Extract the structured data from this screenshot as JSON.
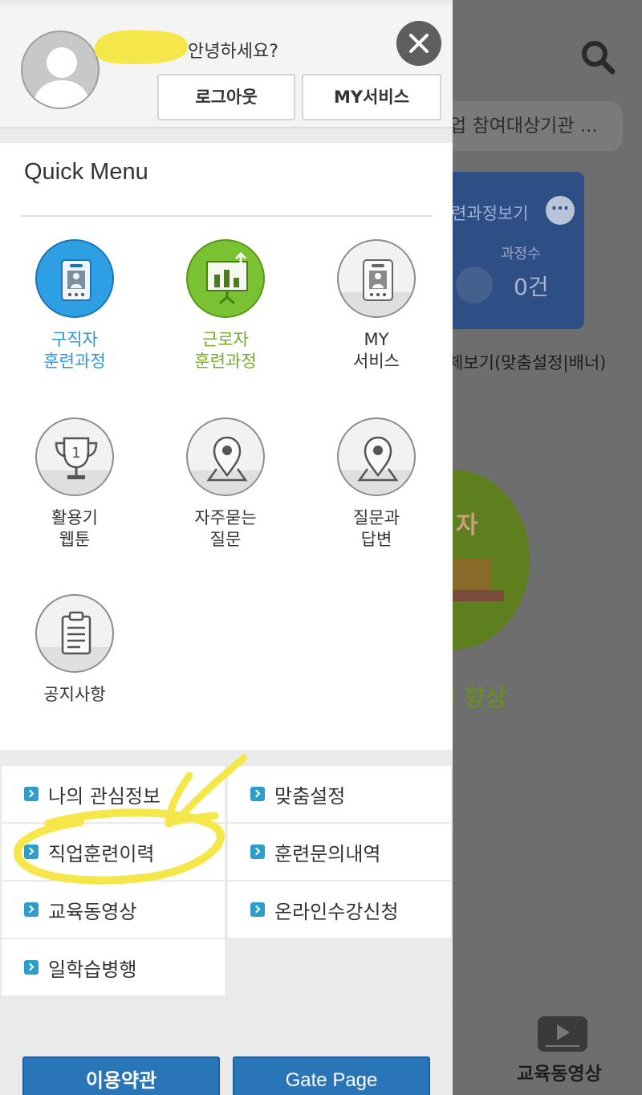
{
  "background": {
    "search_icon": "search-icon",
    "notice_pill": "업 참여대상기관 ...",
    "card": {
      "title": "련과정보기",
      "more_icon": "more-dots-icon",
      "count_label": "과정수",
      "count_value": "0건"
    },
    "banner_label": "체보기(맞춤설정|배너)",
    "green_text": "자",
    "improve_text": "l 향상",
    "bottom_nav": {
      "label": "교육동영상",
      "icon": "video-play-icon"
    }
  },
  "header": {
    "greeting": "안녕하세요?",
    "close_icon": "close-icon",
    "logout_label": "로그아웃",
    "my_service_label": "MY서비스"
  },
  "quick_menu": {
    "title": "Quick Menu",
    "items": [
      {
        "label": "구직자\n훈련과정",
        "icon": "id-card-icon",
        "style": "blue"
      },
      {
        "label": "근로자\n훈련과정",
        "icon": "presentation-chart-icon",
        "style": "green"
      },
      {
        "label": "MY\n서비스",
        "icon": "id-card-icon",
        "style": "gray"
      },
      {
        "label": "활용기\n웹툰",
        "icon": "trophy-icon",
        "style": "gray"
      },
      {
        "label": "자주묻는\n질문",
        "icon": "location-pin-icon",
        "style": "gray"
      },
      {
        "label": "질문과\n답변",
        "icon": "location-pin-icon",
        "style": "gray"
      },
      {
        "label": "공지사항",
        "icon": "clipboard-icon",
        "style": "gray"
      }
    ]
  },
  "links": [
    {
      "label": "나의 관심정보"
    },
    {
      "label": "맞춤설정"
    },
    {
      "label": "직업훈련이력"
    },
    {
      "label": "훈련문의내역"
    },
    {
      "label": "교육동영상"
    },
    {
      "label": "온라인수강신청"
    },
    {
      "label": "일학습병행"
    }
  ],
  "footer": {
    "terms_label": "이용약관",
    "gate_label": "Gate Page"
  },
  "colors": {
    "accent_blue": "#2a74b8",
    "quick_blue": "#2f9fe4",
    "quick_green": "#7bc232",
    "highlight": "#f5e74a"
  }
}
